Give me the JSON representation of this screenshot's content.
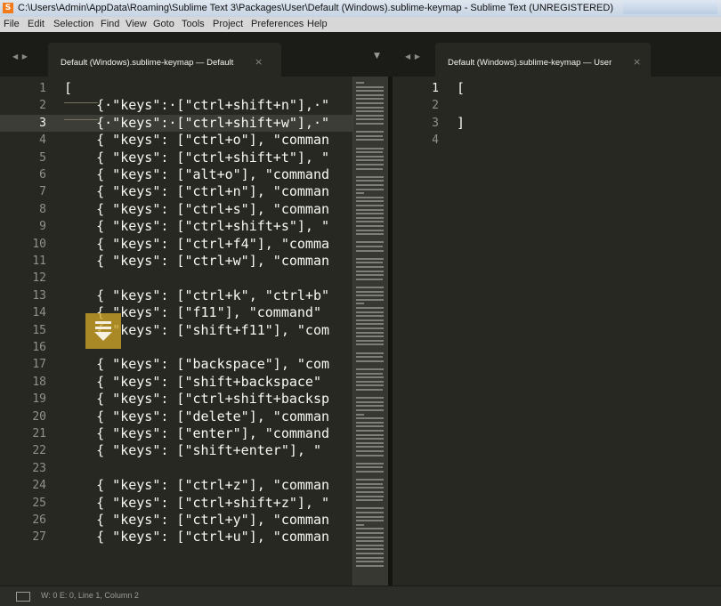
{
  "window": {
    "title": "C:\\Users\\Admin\\AppData\\Roaming\\Sublime Text 3\\Packages\\User\\Default (Windows).sublime-keymap - Sublime Text (UNREGISTERED)"
  },
  "menu": [
    "File",
    "Edit",
    "Selection",
    "Find",
    "View",
    "Goto",
    "Tools",
    "Project",
    "Preferences",
    "Help"
  ],
  "left_pane": {
    "tab_label": "Default (Windows).sublime-keymap — Default",
    "close_glyph": "×",
    "nav_glyph": "◀ ▶",
    "dropdown_glyph": "▼",
    "active_line": 3,
    "lines": [
      "[",
      "{·\"keys\":·[\"ctrl+shift+n\"],·\"",
      "{·\"keys\":·[\"ctrl+shift+w\"],·\"",
      "{ \"keys\": [\"ctrl+o\"], \"comman",
      "{ \"keys\": [\"ctrl+shift+t\"], \"",
      "{ \"keys\": [\"alt+o\"], \"command",
      "{ \"keys\": [\"ctrl+n\"], \"comman",
      "{ \"keys\": [\"ctrl+s\"], \"comman",
      "{ \"keys\": [\"ctrl+shift+s\"], \"",
      "{ \"keys\": [\"ctrl+f4\"], \"comma",
      "{ \"keys\": [\"ctrl+w\"], \"comman",
      "",
      "{ \"keys\": [\"ctrl+k\", \"ctrl+b\"",
      "{ \"keys\": [\"f11\"], \"command\"",
      "{ \"keys\": [\"shift+f11\"], \"com",
      "",
      "{ \"keys\": [\"backspace\"], \"com",
      "{ \"keys\": [\"shift+backspace\"",
      "{ \"keys\": [\"ctrl+shift+backsp",
      "{ \"keys\": [\"delete\"], \"comman",
      "{ \"keys\": [\"enter\"], \"command",
      "{ \"keys\": [\"shift+enter\"], \"",
      "",
      "{ \"keys\": [\"ctrl+z\"], \"comman",
      "{ \"keys\": [\"ctrl+shift+z\"], \"",
      "{ \"keys\": [\"ctrl+y\"], \"comman",
      "{ \"keys\": [\"ctrl+u\"], \"comman"
    ]
  },
  "right_pane": {
    "tab_label": "Default (Windows).sublime-keymap — User",
    "close_glyph": "×",
    "nav_glyph": "◀ ▶",
    "active_line": 1,
    "lines": [
      "[",
      "",
      "]",
      ""
    ]
  },
  "status": {
    "text": "W: 0 E: 0, Line 1, Column 2"
  },
  "colors": {
    "background": "#272822",
    "tab_bar": "#1b1b18",
    "line_number": "#8f908a",
    "text": "#f8f8f2",
    "scroll_overlay": "#cda528"
  }
}
